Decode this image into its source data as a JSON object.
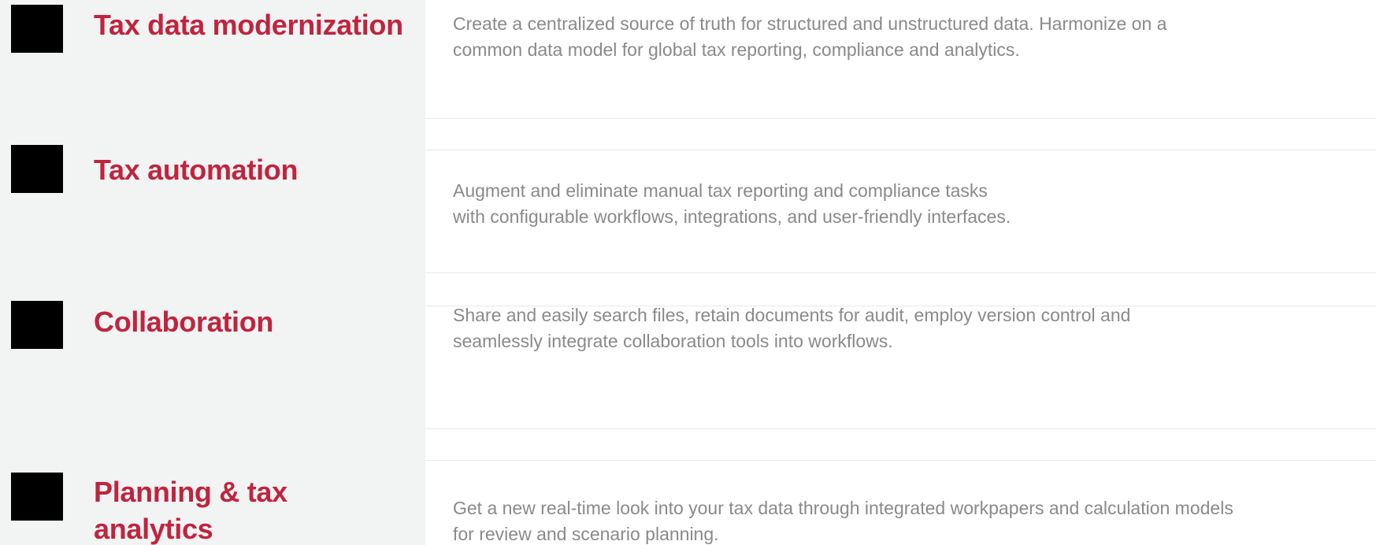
{
  "colors": {
    "title": "#c0243f",
    "body_text": "#8a8a8a",
    "left_panel": "#f2f3f3",
    "icon_box": "#000000"
  },
  "rows": [
    {
      "icon": "black-square-icon",
      "title": "Tax data modernization",
      "description_lines": [
        "Create a centralized source of truth for structured and unstructured data. Harmonize on a",
        "common data model for global tax reporting, compliance and analytics."
      ]
    },
    {
      "icon": "black-square-icon",
      "title": "Tax automation",
      "description_lines": [
        "Augment and eliminate manual tax reporting and compliance tasks",
        "with configurable workflows, integrations, and user-friendly interfaces."
      ]
    },
    {
      "icon": "black-square-icon",
      "title": "Collaboration",
      "description_lines": [
        "Share and easily search files, retain documents for audit, employ version control and",
        "seamlessly integrate collaboration tools into workflows."
      ]
    },
    {
      "icon": "black-square-icon",
      "title": "Planning & tax analytics",
      "description_lines": [
        "Get a new real-time look into your tax data through integrated workpapers and calculation models",
        "for review and scenario planning."
      ]
    }
  ]
}
